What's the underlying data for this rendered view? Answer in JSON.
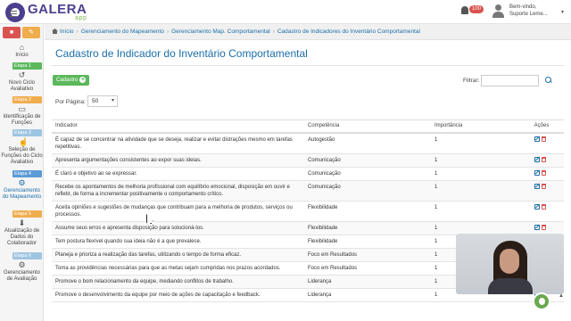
{
  "header": {
    "logo_text": "GALERA",
    "logo_sub": "app",
    "notification_count": "100",
    "user_greeting": "Bem-vindo,",
    "user_name": "Suporte Leme..."
  },
  "sidebar": {
    "items": [
      {
        "label": "Início",
        "icon": "home-icon"
      },
      {
        "stage": "Etapa 1",
        "label": "Novo Ciclo Avaliativo",
        "icon": "history-icon"
      },
      {
        "stage": "Etapa 2",
        "label": "Identificação de Funções",
        "icon": "inbox-icon"
      },
      {
        "stage": "Etapa 3",
        "label": "Seleção de Funções do Ciclo Avaliativo",
        "icon": "hand-pointer-icon"
      },
      {
        "stage": "Etapa 4",
        "label": "Gerenciamento do Mapeamento",
        "icon": "cogs-icon"
      },
      {
        "stage": "Etapa 5",
        "label": "Atualização de Dados do Colaborador",
        "icon": "download-icon"
      },
      {
        "stage": "Etapa 6",
        "label": "Gerenciamento de Avaliação",
        "icon": "cogs-icon"
      }
    ]
  },
  "breadcrumb": [
    "Início",
    "Gerenciamento do Mapeamento",
    "Gerenciamento Map. Comportamental",
    "Cadastro de Indicadores do Inventário Comportamental"
  ],
  "page": {
    "title": "Cadastro de Indicador do Inventário Comportamental",
    "add_label": "Cadastro",
    "filter_label": "Filtrar:",
    "filter_value": "",
    "per_page_label": "Por Página:",
    "per_page_value": "50"
  },
  "table": {
    "headers": [
      "Indicador",
      "Competência",
      "Importância",
      "Ações"
    ],
    "rows": [
      {
        "indicador": "É capaz de se concentrar na atividade que se deseja, realizar e evitar distrações mesmo em tarefas repetitivas.",
        "competencia": "Autogestão",
        "importancia": "1"
      },
      {
        "indicador": "Apresenta argumentações consistentes ao expor suas ideias.",
        "competencia": "Comunicação",
        "importancia": "1"
      },
      {
        "indicador": "É claro e objetivo ao se expressar.",
        "competencia": "Comunicação",
        "importancia": "1"
      },
      {
        "indicador": "Recebe os apontamentos de melhoria profissional com equilíbrio emocional, disposição em ouvir e refletir, de forma a incrementar positivamente o comportamento crítico.",
        "competencia": "Comunicação",
        "importancia": "1"
      },
      {
        "indicador": "Aceita opiniões e sugestões de mudanças que contribuam para a melhoria de produtos, serviços ou processos.",
        "competencia": "Flexibilidade",
        "importancia": "1"
      },
      {
        "indicador": "Assume seus erros e apresenta disposição para solucioná-los.",
        "competencia": "Flexibilidade",
        "importancia": "1"
      },
      {
        "indicador": "Tem postura flexível quando sua ideia não é a que prevalece.",
        "competencia": "Flexibilidade",
        "importancia": "1"
      },
      {
        "indicador": "Planeja e prioriza a realização das tarefas, utilizando o tempo de forma eficaz.",
        "competencia": "Foco em Resultados",
        "importancia": "1"
      },
      {
        "indicador": "Toma as providências necessárias para que as metas sejam cumpridas nos prazos acordados.",
        "competencia": "Foco em Resultados",
        "importancia": "1"
      },
      {
        "indicador": "Promove o bom relacionamento da equipe, mediando conflitos de trabalho.",
        "competencia": "Liderança",
        "importancia": "1"
      },
      {
        "indicador": "Promove o desenvolvimento da equipe por meio de ações de capacitação e feedback.",
        "competencia": "Liderança",
        "importancia": "1"
      }
    ]
  }
}
